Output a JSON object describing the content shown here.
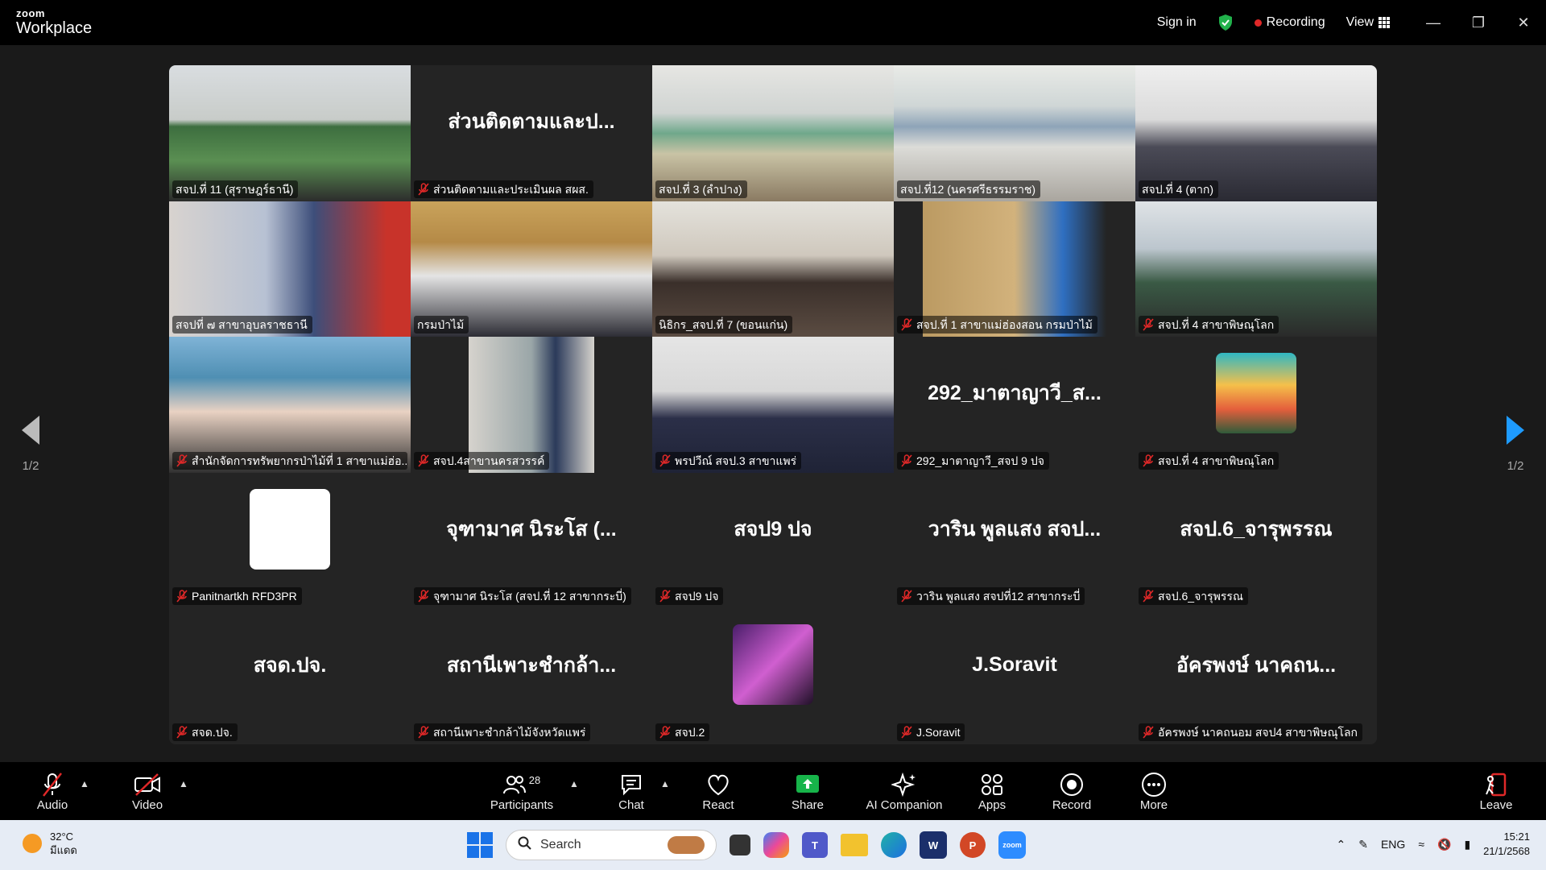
{
  "titlebar": {
    "brand_small": "zoom",
    "brand_big": "Workplace",
    "sign_in": "Sign in",
    "recording": "Recording",
    "view": "View"
  },
  "pager": {
    "left": "1/2",
    "right": "1/2"
  },
  "tiles": [
    {
      "label": "สจป.ที่ 11 (สุราษฎร์ธานี)",
      "big": "",
      "muted": false,
      "video": "v1"
    },
    {
      "label": "ส่วนติดตามและประเมินผล สผส.",
      "big": "ส่วนติดตามและป...",
      "muted": true,
      "video": ""
    },
    {
      "label": "สจป.ที่ 3 (ลำปาง)",
      "big": "",
      "muted": false,
      "video": "v3"
    },
    {
      "label": "สจป.ที่12 (นครศรีธรรมราช)",
      "big": "",
      "muted": false,
      "video": "v4"
    },
    {
      "label": "สจป.ที่ 4 (ตาก)",
      "big": "",
      "muted": false,
      "video": "v5"
    },
    {
      "label": "สจปที่ ๗ สาขาอุบลราชธานี",
      "big": "",
      "muted": false,
      "video": "v6"
    },
    {
      "label": "กรมป่าไม้",
      "big": "",
      "muted": false,
      "video": "v7"
    },
    {
      "label": "นิธิกร_สจป.ที่ 7 (ขอนแก่น)",
      "big": "",
      "muted": false,
      "video": "v8"
    },
    {
      "label": "สจป.ที่ 1 สาขาแม่ฮ่องสอน กรมป่าไม้",
      "big": "",
      "muted": true,
      "video": "v9"
    },
    {
      "label": "สจป.ที่ 4 สาขาพิษณุโลก",
      "big": "",
      "muted": true,
      "video": "v10"
    },
    {
      "label": "สำนักจัดการทรัพยากรป่าไม้ที่ 1 สาขาแม่ฮ่อ...",
      "big": "",
      "muted": true,
      "video": "v11"
    },
    {
      "label": "สจป.4สาขานครสวรรค์",
      "big": "",
      "muted": true,
      "video": "v12"
    },
    {
      "label": "พรปวีณ์ สจป.3 สาขาแพร่",
      "big": "",
      "muted": true,
      "video": "v13"
    },
    {
      "label": "292_มาตาญาวี_สจป 9 ปจ",
      "big": "292_มาตาญาวี_ส...",
      "muted": true,
      "video": ""
    },
    {
      "label": "สจป.ที่ 4 สาขาพิษณุโลก",
      "big": "",
      "muted": true,
      "video": "a15"
    },
    {
      "label": "Panitnartkh RFD3PR",
      "big": "",
      "muted": true,
      "video": "a16"
    },
    {
      "label": "จุฑามาศ นิระโส (สจป.ที่ 12 สาขากระบี่)",
      "big": "จุฑามาศ นิระโส (...",
      "muted": true,
      "video": ""
    },
    {
      "label": "สจป9 ปจ",
      "big": "สจป9 ปจ",
      "muted": true,
      "video": ""
    },
    {
      "label": "วาริน พูลแสง สจปที่12 สาขากระบี่",
      "big": "วาริน พูลแสง สจป...",
      "muted": true,
      "video": ""
    },
    {
      "label": "สจป.6_จารุพรรณ",
      "big": "สจป.6_จารุพรรณ",
      "muted": true,
      "video": ""
    },
    {
      "label": "สจด.ปจ.",
      "big": "สจด.ปจ.",
      "muted": true,
      "video": ""
    },
    {
      "label": "สถานีเพาะชำกล้าไม้จังหวัดแพร่",
      "big": "สถานีเพาะชำกล้า...",
      "muted": true,
      "video": ""
    },
    {
      "label": "สจป.2",
      "big": "",
      "muted": true,
      "video": "a23"
    },
    {
      "label": "J.Soravit",
      "big": "J.Soravit",
      "muted": true,
      "video": ""
    },
    {
      "label": "อัครพงษ์ นาคถนอม สจป4 สาขาพิษณุโลก",
      "big": "อัครพงษ์ นาคถน...",
      "muted": true,
      "video": ""
    }
  ],
  "toolbar": {
    "audio": "Audio",
    "video": "Video",
    "participants": "Participants",
    "participants_count": "28",
    "chat": "Chat",
    "react": "React",
    "share": "Share",
    "ai": "AI Companion",
    "apps": "Apps",
    "record": "Record",
    "more": "More",
    "leave": "Leave"
  },
  "taskbar": {
    "temp": "32°C",
    "weather": "มีแดด",
    "search": "Search",
    "lang": "ENG",
    "time": "15:21",
    "date": "21/1/2568"
  },
  "colors": {
    "accent_green": "#3ddc84",
    "share_green": "#17b44a",
    "record_red": "#e02828",
    "nav_blue": "#1e9bff"
  }
}
